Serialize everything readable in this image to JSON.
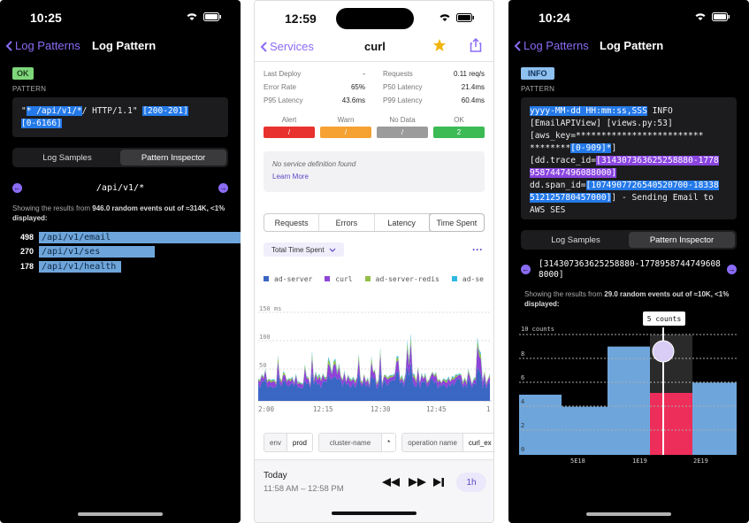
{
  "left": {
    "time": "10:25",
    "back_label": "Log Patterns",
    "title": "Log Pattern",
    "status_tag": "OK",
    "section_label": "PATTERN",
    "pattern": {
      "p1": "\"",
      "p2": "*",
      "p3": " /api/v1/*",
      "p4": "/ HTTP/1.1\" ",
      "p5": "[200-201]",
      "p6": "[0-6166]"
    },
    "tabs": [
      "Log Samples",
      "Pattern Inspector"
    ],
    "inspector_path": "/api/v1/*",
    "summary_prefix": "Showing the results from ",
    "summary_bold": "946.0 random events out of ≈314K, <1% displayed:",
    "values": [
      {
        "count": "498",
        "label": "/api/v1/email",
        "share": 1.0
      },
      {
        "count": "270",
        "label": "/api/v1/ses",
        "share": 0.56
      },
      {
        "count": "178",
        "label": "/api/v1/health",
        "share": 0.4
      }
    ]
  },
  "middle": {
    "time": "12:59",
    "back_label": "Services",
    "title": "curl",
    "stats": [
      {
        "label": "Last Deploy",
        "value": "-",
        "label2": "Requests",
        "value2": "0.11 req/s"
      },
      {
        "label": "Error Rate",
        "value": "65%",
        "label2": "P50 Latency",
        "value2": "21.4ms"
      },
      {
        "label": "P95 Latency",
        "value": "43.6ms",
        "label2": "P99 Latency",
        "value2": "60.4ms"
      }
    ],
    "monitors": [
      {
        "label": "Alert",
        "value": "/",
        "color": "#e8322e"
      },
      {
        "label": "Warn",
        "value": "/",
        "color": "#f5a232"
      },
      {
        "label": "No Data",
        "value": "/",
        "color": "#9b9b9b"
      },
      {
        "label": "OK",
        "value": "2",
        "color": "#3cba54"
      }
    ],
    "no_definition": "No service definition found",
    "learn_more": "Learn More",
    "tabs": [
      "Requests",
      "Errors",
      "Latency",
      "Time Spent"
    ],
    "dropdown": "Total Time Spent",
    "legend": [
      {
        "name": "ad-server",
        "color": "#3a66c4"
      },
      {
        "name": "curl",
        "color": "#8e44d9"
      },
      {
        "name": "ad-server-redis",
        "color": "#94c04a"
      },
      {
        "name": "ad-se",
        "color": "#2fb8e6"
      }
    ],
    "chart_data": {
      "type": "area",
      "y_ticks": [
        "150 ms",
        "100",
        "50"
      ],
      "x_ticks": [
        "2:00",
        "12:15",
        "12:30",
        "12:45",
        "1"
      ],
      "ylim": [
        0,
        150
      ]
    },
    "filters": [
      {
        "key": "env",
        "value": "prod"
      },
      {
        "key": "cluster-name",
        "value": "*"
      },
      {
        "key": "operation name",
        "value": "curl_ex"
      }
    ],
    "bottom": {
      "day": "Today",
      "range": "11:58 AM – 12:58 PM",
      "interval": "1h"
    }
  },
  "right": {
    "time": "10:24",
    "back_label": "Log Patterns",
    "title": "Log Pattern",
    "status_tag": "INFO",
    "section_label": "PATTERN",
    "pattern": {
      "l1": "yyyy-MM-dd HH:mm:ss,SSS",
      "l1b": " INFO",
      "l2": "[EmailAPIView] [views.py:53]",
      "l3": "[aws_key=*************************",
      "l4a": "********",
      "l4b": "[0-909]*",
      "l4c": "]",
      "l5a": "[dd.trace_id=",
      "l5b": "[314307363625258880-1778",
      "l6": "9587447496088000]",
      "l7a": "dd.span_id=",
      "l7b": "[1074907726540520700-18338",
      "l8a": "512125780457000]",
      "l8b": "] - Sending Email to",
      "l9": "AWS SES"
    },
    "tabs": [
      "Log Samples",
      "Pattern Inspector"
    ],
    "inspector_range": "[314307363625258880-17789587447496088000]",
    "summary_prefix": "Showing the results from ",
    "summary_bold": "29.0 random events out of ≈10K, <1% displayed:",
    "tooltip": "5 counts",
    "chart_data": {
      "type": "bar",
      "y_ticks": [
        "10 counts",
        "8",
        "6",
        "4",
        "2",
        "0"
      ],
      "x_ticks": [
        "5E18",
        "1E19",
        "2E19"
      ],
      "ylim": [
        0,
        10
      ],
      "values": [
        5,
        4,
        9,
        6,
        6
      ]
    }
  }
}
